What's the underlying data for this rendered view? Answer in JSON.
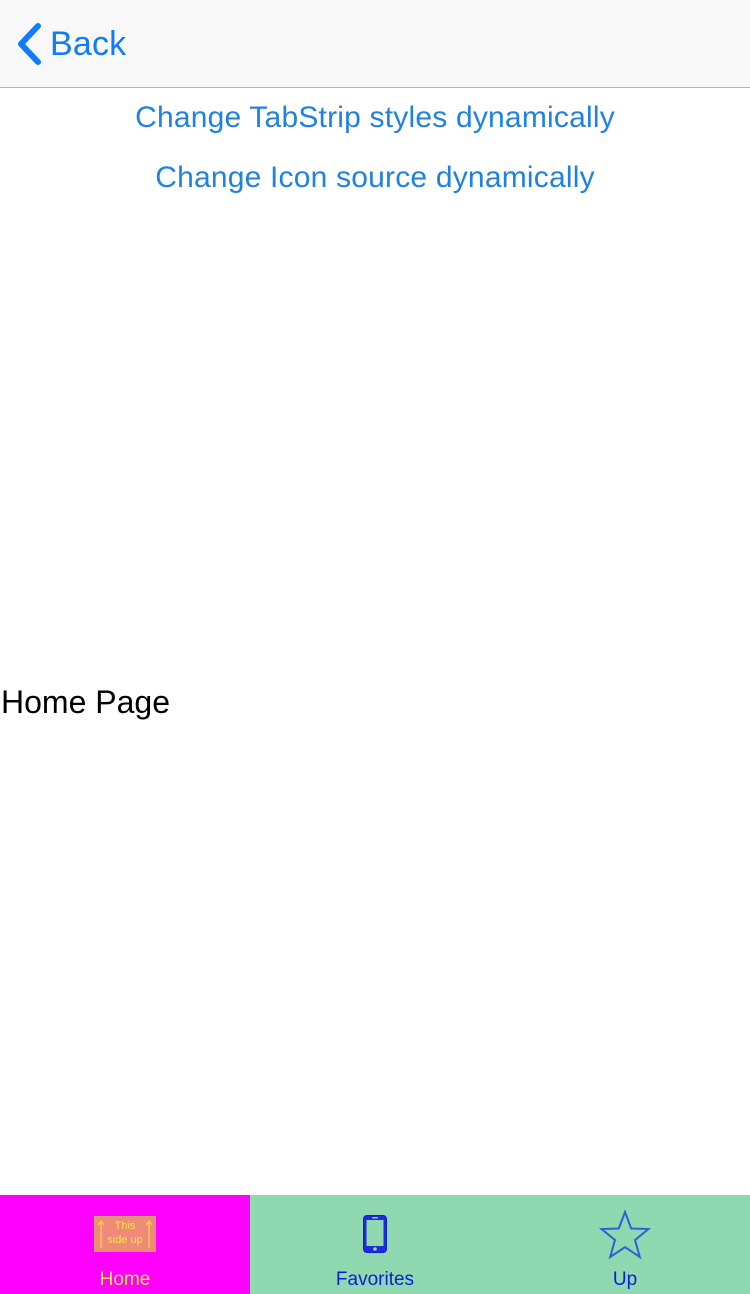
{
  "nav": {
    "back_label": "Back",
    "back_icon": "chevron-left-icon"
  },
  "content": {
    "link_tabstrip_styles": "Change TabStrip styles dynamically",
    "link_icon_source": "Change Icon source dynamically",
    "page_label": "Home Page"
  },
  "tabs": {
    "items": [
      {
        "label": "Home",
        "icon": "this-side-up-icon",
        "icon_text_line1": "This",
        "icon_text_line2": "side up",
        "selected": true
      },
      {
        "label": "Favorites",
        "icon": "smartphone-icon",
        "selected": false
      },
      {
        "label": "Up",
        "icon": "star-icon",
        "selected": false
      }
    ]
  },
  "colors": {
    "accent": "#0f7dfa",
    "tab_background": "#8fd8b0",
    "tab_selected_background": "#ff00ff",
    "tab_selected_text": "#ffe24a",
    "tab_text": "#0a1fd6"
  }
}
